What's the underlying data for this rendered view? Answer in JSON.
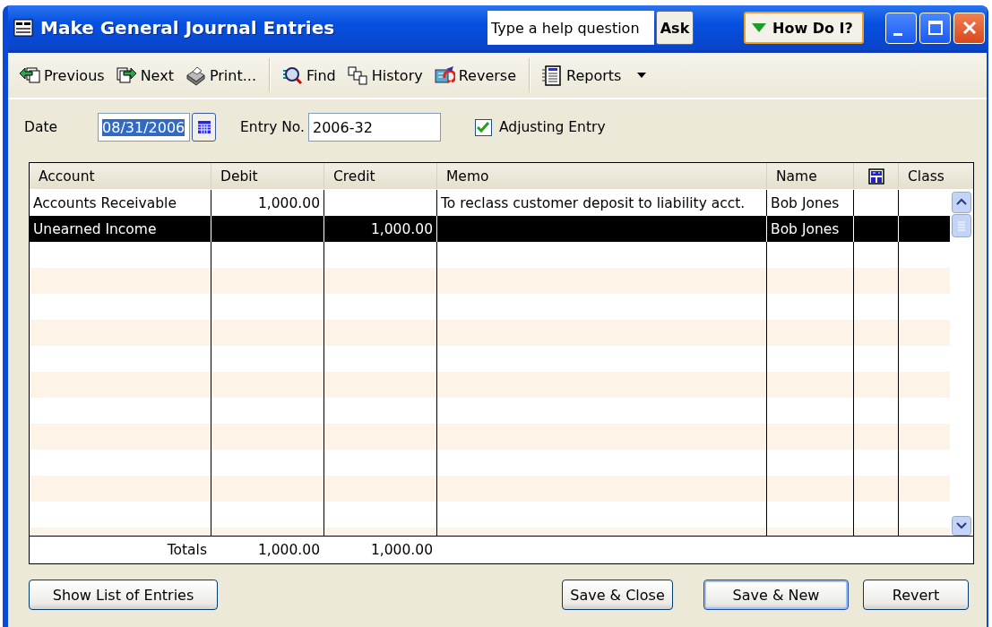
{
  "window": {
    "title": "Make General Journal Entries"
  },
  "help": {
    "placeholder": "Type a help question",
    "ask_button": "Ask",
    "how_do_i_button": "How Do I?"
  },
  "toolbar": [
    [
      {
        "label": "Previous",
        "has_menu": false
      },
      {
        "label": "Next",
        "has_menu": false
      },
      {
        "label": "Print...",
        "has_menu": false
      }
    ],
    [
      {
        "label": "Find",
        "has_menu": false
      },
      {
        "label": "History",
        "has_menu": false
      },
      {
        "label": "Reverse",
        "has_menu": false
      }
    ],
    [
      {
        "label": "Reports",
        "has_menu": true
      }
    ]
  ],
  "form": {
    "date_label": "Date",
    "date": "08/31/2006",
    "date_highlighted": true,
    "entry_no_label": "Entry No.",
    "entry_no": "2006-32",
    "adjusting_entry": {
      "label": "Adjusting Entry",
      "checked": true
    }
  },
  "table": {
    "columns": [
      "Account",
      "Debit",
      "Credit",
      "Memo",
      "Name",
      "",
      "Class"
    ],
    "rows": [
      {
        "account": "Accounts Receivable",
        "debit": "1,000.00",
        "credit": "",
        "memo": "To reclass customer deposit to liability acct.",
        "name": "Bob Jones",
        "selected": false
      },
      {
        "account": "Unearned Income",
        "debit": "",
        "credit": "1,000.00",
        "memo": "",
        "name": "Bob Jones",
        "selected": true
      }
    ],
    "totals": {
      "label": "Totals",
      "debit": "1,000.00",
      "credit": "1,000.00"
    }
  },
  "buttons": [
    {
      "label": "Show List of Entries",
      "default": false
    },
    {
      "label": "Save & Close",
      "default": false
    },
    {
      "label": "Save & New",
      "default": true
    },
    {
      "label": "Revert",
      "default": false
    }
  ]
}
